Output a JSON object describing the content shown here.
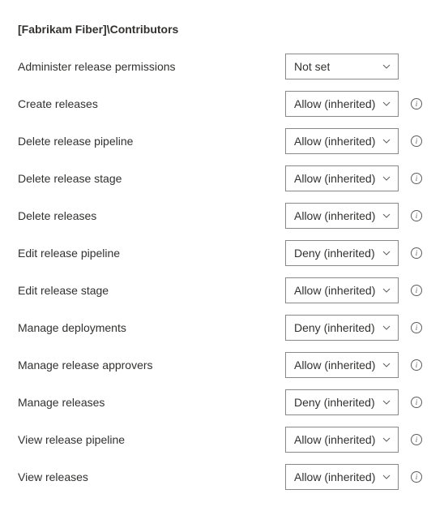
{
  "title": "[Fabrikam Fiber]\\Contributors",
  "permissions": [
    {
      "label": "Administer release permissions",
      "value": "Not set",
      "info": false
    },
    {
      "label": "Create releases",
      "value": "Allow (inherited)",
      "info": true
    },
    {
      "label": "Delete release pipeline",
      "value": "Allow (inherited)",
      "info": true
    },
    {
      "label": "Delete release stage",
      "value": "Allow (inherited)",
      "info": true
    },
    {
      "label": "Delete releases",
      "value": "Allow (inherited)",
      "info": true
    },
    {
      "label": "Edit release pipeline",
      "value": "Deny (inherited)",
      "info": true
    },
    {
      "label": "Edit release stage",
      "value": "Allow (inherited)",
      "info": true
    },
    {
      "label": "Manage deployments",
      "value": "Deny (inherited)",
      "info": true
    },
    {
      "label": "Manage release approvers",
      "value": "Allow (inherited)",
      "info": true
    },
    {
      "label": "Manage releases",
      "value": "Deny (inherited)",
      "info": true
    },
    {
      "label": "View release pipeline",
      "value": "Allow (inherited)",
      "info": true
    },
    {
      "label": "View releases",
      "value": "Allow (inherited)",
      "info": true
    }
  ]
}
